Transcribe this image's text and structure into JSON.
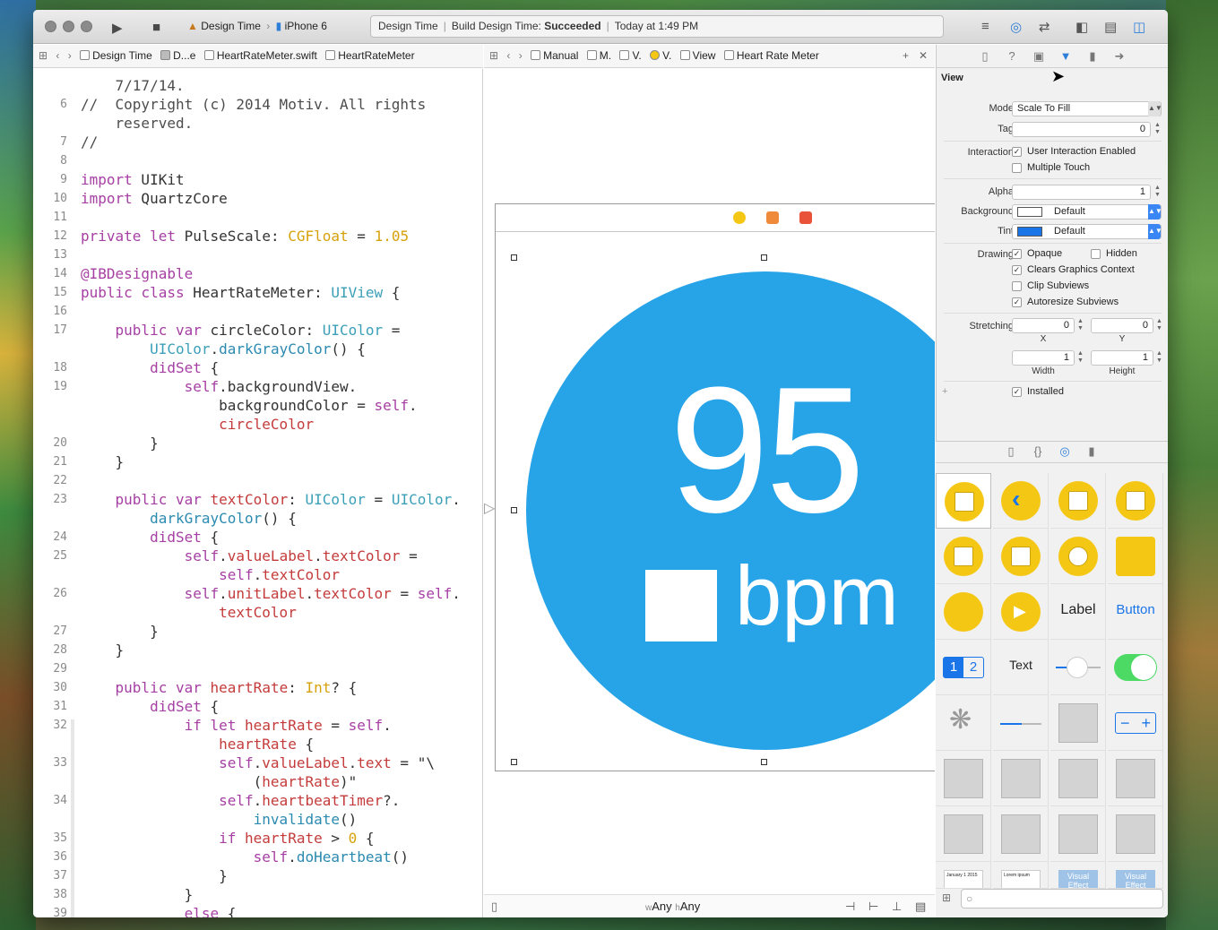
{
  "toolbar": {
    "scheme_target": "Design Time",
    "scheme_device": "iPhone 6",
    "activity_target": "Design Time",
    "activity_status_prefix": "Build Design Time:",
    "activity_status": "Succeeded",
    "activity_time": "Today at 1:49 PM"
  },
  "editor_jumpbar": {
    "items": [
      "Design Time",
      "D...e",
      "HeartRateMeter.swift",
      "HeartRateMeter"
    ]
  },
  "canvas_jumpbar": {
    "items": [
      "Manual",
      "M.",
      "V.",
      "V.",
      "View",
      "Heart Rate Meter"
    ]
  },
  "code": {
    "lines": [
      {
        "n": "",
        "t": "    7/17/14."
      },
      {
        "n": "6",
        "t": "//  Copyright (c) 2014 Motiv. All rights"
      },
      {
        "n": "",
        "t": "    reserved."
      },
      {
        "n": "7",
        "t": "//"
      },
      {
        "n": "8",
        "t": ""
      },
      {
        "n": "9",
        "t": "import UIKit"
      },
      {
        "n": "10",
        "t": "import QuartzCore"
      },
      {
        "n": "11",
        "t": ""
      },
      {
        "n": "12",
        "t": "private let PulseScale: CGFloat = 1.05"
      },
      {
        "n": "13",
        "t": ""
      },
      {
        "n": "14",
        "t": "@IBDesignable"
      },
      {
        "n": "15",
        "t": "public class HeartRateMeter: UIView {"
      },
      {
        "n": "16",
        "t": ""
      },
      {
        "n": "17",
        "t": "    public var circleColor: UIColor ="
      },
      {
        "n": "",
        "t": "        UIColor.darkGrayColor() {"
      },
      {
        "n": "18",
        "t": "        didSet {"
      },
      {
        "n": "19",
        "t": "            self.backgroundView."
      },
      {
        "n": "",
        "t": "                backgroundColor = self."
      },
      {
        "n": "",
        "t": "                circleColor"
      },
      {
        "n": "20",
        "t": "        }"
      },
      {
        "n": "21",
        "t": "    }"
      },
      {
        "n": "22",
        "t": ""
      },
      {
        "n": "23",
        "t": "    public var textColor: UIColor = UIColor."
      },
      {
        "n": "",
        "t": "        darkGrayColor() {"
      },
      {
        "n": "24",
        "t": "        didSet {"
      },
      {
        "n": "25",
        "t": "            self.valueLabel.textColor ="
      },
      {
        "n": "",
        "t": "                self.textColor"
      },
      {
        "n": "26",
        "t": "            self.unitLabel.textColor = self."
      },
      {
        "n": "",
        "t": "                textColor"
      },
      {
        "n": "27",
        "t": "        }"
      },
      {
        "n": "28",
        "t": "    }"
      },
      {
        "n": "29",
        "t": ""
      },
      {
        "n": "30",
        "t": "    public var heartRate: Int? {"
      },
      {
        "n": "31",
        "t": "        didSet {"
      },
      {
        "n": "32",
        "t": "            if let heartRate = self."
      },
      {
        "n": "",
        "t": "                heartRate {"
      },
      {
        "n": "33",
        "t": "                self.valueLabel.text = \"\\"
      },
      {
        "n": "",
        "t": "                    (heartRate)\""
      },
      {
        "n": "34",
        "t": "                self.heartbeatTimer?."
      },
      {
        "n": "",
        "t": "                    invalidate()"
      },
      {
        "n": "35",
        "t": "                if heartRate > 0 {"
      },
      {
        "n": "36",
        "t": "                    self.doHeartbeat()"
      },
      {
        "n": "37",
        "t": "                }"
      },
      {
        "n": "38",
        "t": "            }"
      },
      {
        "n": "39",
        "t": "            else {"
      }
    ]
  },
  "canvas": {
    "rate_value": "95",
    "unit": "bpm",
    "size_class_w_prefix": "w",
    "size_class_w": "Any",
    "size_class_h_prefix": "h",
    "size_class_h": "Any"
  },
  "inspector": {
    "section_title": "View",
    "mode_label": "Mode",
    "mode_value": "Scale To Fill",
    "tag_label": "Tag",
    "tag_value": "0",
    "interaction_label": "Interaction",
    "user_interaction": "User Interaction Enabled",
    "multiple_touch": "Multiple Touch",
    "alpha_label": "Alpha",
    "alpha_value": "1",
    "background_label": "Background",
    "background_value": "Default",
    "tint_label": "Tint",
    "tint_value": "Default",
    "drawing_label": "Drawing",
    "opaque": "Opaque",
    "hidden": "Hidden",
    "clears_graphics": "Clears Graphics Context",
    "clip_subviews": "Clip Subviews",
    "autoresize_subviews": "Autoresize Subviews",
    "stretching_label": "Stretching",
    "stretch_x": "0",
    "stretch_y": "0",
    "x_label": "X",
    "y_label": "Y",
    "stretch_width": "1",
    "stretch_height": "1",
    "width_label": "Width",
    "height_label": "Height",
    "installed": "Installed",
    "plus": "+",
    "tint_color": "#1a75e8"
  },
  "library": {
    "label_text": "Label",
    "button_text": "Button",
    "text_text": "Text",
    "segment_1": "1",
    "segment_2": "2",
    "visual_effect_1": "Visual Effect",
    "visual_effect_2": "Visual Effect",
    "date_text": "January 1 2015",
    "lorem_text": "Lorem ipsum"
  }
}
